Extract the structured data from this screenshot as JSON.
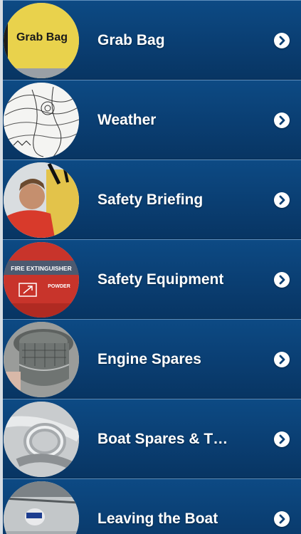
{
  "menu": {
    "items": [
      {
        "label": "Grab Bag",
        "thumb_text": "Grab Bag"
      },
      {
        "label": "Weather"
      },
      {
        "label": "Safety Briefing"
      },
      {
        "label": "Safety Equipment",
        "thumb_text_1": "FIRE EXTINGUISHER",
        "thumb_text_2": "POWDER"
      },
      {
        "label": "Engine Spares"
      },
      {
        "label": "Boat Spares & T…"
      },
      {
        "label": "Leaving the Boat"
      }
    ]
  },
  "colors": {
    "row_blue": "#0a3f73",
    "divider": "#5f8fbd",
    "text": "#ffffff",
    "chevron_bg": "#ffffff",
    "chevron_fg": "#0a3f73"
  }
}
